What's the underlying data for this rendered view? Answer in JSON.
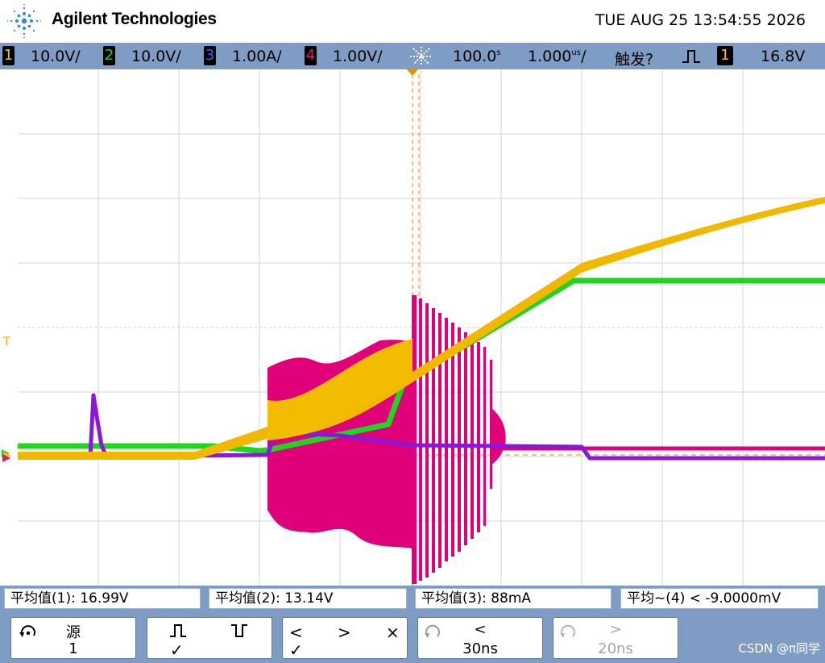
{
  "header": {
    "brand": "Agilent Technologies",
    "datetime": "TUE AUG 25 13:54:55 2026"
  },
  "status": {
    "ch1": {
      "num": "1",
      "scale": "10.0V/",
      "color": "#f5c400"
    },
    "ch2": {
      "num": "2",
      "scale": "10.0V/",
      "color": "#22d422"
    },
    "ch3": {
      "num": "3",
      "scale": "1.00A/",
      "color": "#4060ff"
    },
    "ch4": {
      "num": "4",
      "scale": "1.00V/",
      "color": "#e0187a"
    },
    "timebase": "100.0",
    "timebase_unit": "ns",
    "timebase_superscript": "s",
    "delay": "1.000",
    "delay_unit": "us",
    "trigger_label": "触发?",
    "trigger_source": "1",
    "trigger_level": "16.8V"
  },
  "markers": {
    "trigger_level_marker": "T"
  },
  "measurements": [
    {
      "label": "平均值(1): 16.99V"
    },
    {
      "label": "平均值(2): 13.14V"
    },
    {
      "label": "平均值(3): 88mA"
    },
    {
      "label": "平均~(4) < -9.0000mV"
    }
  ],
  "softkeys": {
    "source": {
      "line1": "源",
      "line2": "1"
    },
    "slope": {
      "rise": "⎍",
      "fall": "⎎",
      "check": "✓"
    },
    "cursors": {
      "left": "<",
      "right": ">",
      "cross": "×",
      "check": "✓"
    },
    "step_back": {
      "line1": "<",
      "line2": "30ns"
    },
    "step_fwd": {
      "line1": ">",
      "line2": "20ns"
    }
  },
  "watermark": "CSDN @π同学"
}
